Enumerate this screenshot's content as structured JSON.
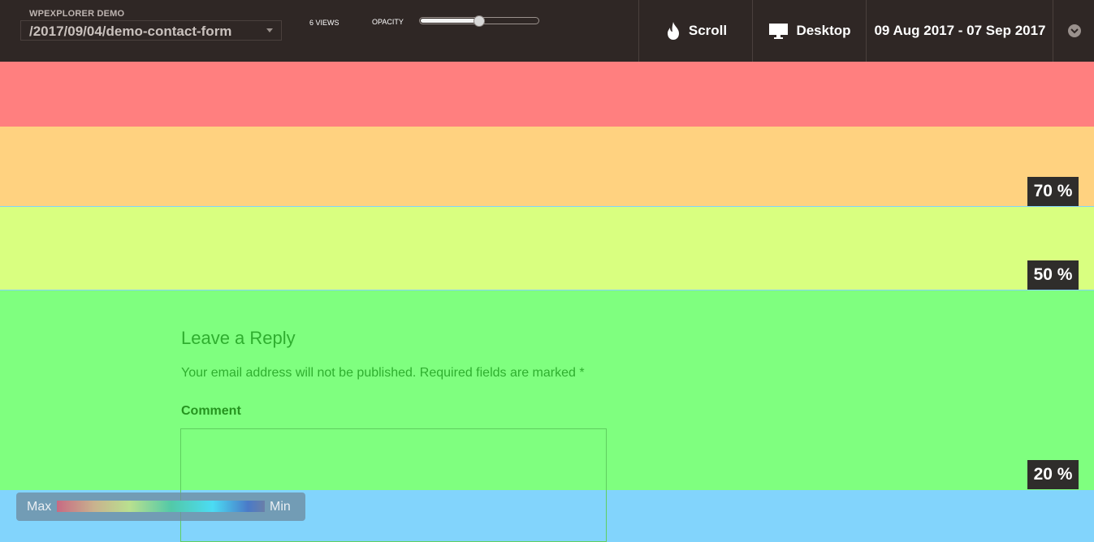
{
  "header": {
    "site_label": "WPEXPLORER DEMO",
    "page_path": "/2017/09/04/demo-contact-form",
    "views": "6 VIEWS",
    "opacity_label": "OPACITY",
    "opacity_value": 0.5,
    "mode_label": "Scroll",
    "mode_icon": "flame-icon",
    "device_label": "Desktop",
    "device_icon": "monitor-icon",
    "date_range": "09 Aug 2017 - 07 Sep 2017",
    "menu_icon": "chevron-down-icon"
  },
  "heatmap": {
    "bands": [
      {
        "color": "#ff7f7f"
      },
      {
        "color": "#ffd280",
        "label": "70 %"
      },
      {
        "color": "#d9ff80",
        "label": "50 %"
      },
      {
        "color": "#7fff7f",
        "label": "20 %"
      },
      {
        "color": "#82d4fc"
      }
    ]
  },
  "content": {
    "reply_title": "Leave a Reply",
    "reply_note": "Your email address will not be published. Required fields are marked *",
    "comment_label": "Comment"
  },
  "legend": {
    "max_label": "Max",
    "min_label": "Min"
  }
}
